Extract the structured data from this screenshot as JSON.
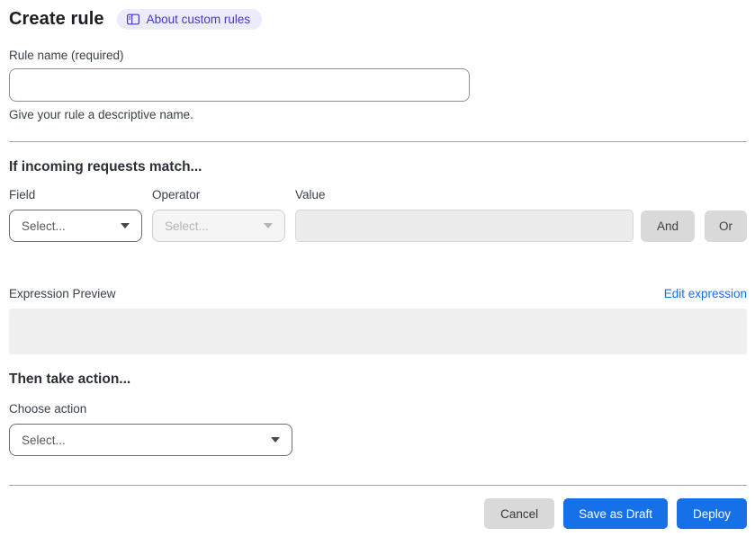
{
  "header": {
    "title": "Create rule",
    "badge": {
      "icon": "book-open-icon",
      "label": "About custom rules"
    }
  },
  "rule_name": {
    "label": "Rule name (required)",
    "value": "",
    "helper": "Give your rule a descriptive name."
  },
  "match_section": {
    "heading": "If incoming requests match...",
    "field": {
      "label": "Field",
      "selected": "Select..."
    },
    "operator": {
      "label": "Operator",
      "selected": "Select..."
    },
    "value": {
      "label": "Value",
      "value": ""
    },
    "and_label": "And",
    "or_label": "Or",
    "preview_label": "Expression Preview",
    "edit_link": "Edit expression",
    "expression_value": ""
  },
  "action_section": {
    "heading": "Then take action...",
    "choose_label": "Choose action",
    "selected": "Select..."
  },
  "footer": {
    "cancel": "Cancel",
    "save_draft": "Save as Draft",
    "deploy": "Deploy"
  },
  "colors": {
    "accent_blue": "#1670e8",
    "link_blue": "#1a6ee0",
    "badge_bg": "#ebebfa",
    "badge_text": "#4338ca",
    "disabled_bg": "#ececec",
    "gray_button": "#d9d9d9",
    "divider": "#a6a6a6"
  }
}
